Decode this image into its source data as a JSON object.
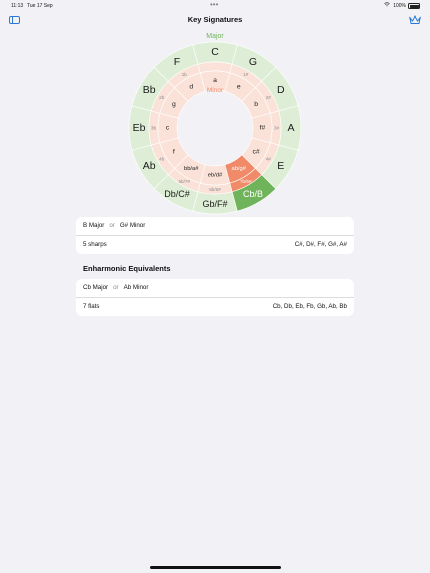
{
  "status_bar": {
    "time": "11:13",
    "date": "Tue 17 Sep",
    "battery": "100%"
  },
  "nav": {
    "title": "Key Signatures"
  },
  "circle": {
    "major_label": "Major",
    "minor_label": "Minor",
    "major_keys": [
      "C",
      "G",
      "D",
      "A",
      "E",
      "Cb/B",
      "Gb/F#",
      "Db/C#",
      "Ab",
      "Eb",
      "Bb",
      "F"
    ],
    "accidentals": [
      "",
      "1#",
      "2#",
      "3#",
      "4#",
      "7b/5#",
      "6b/6#",
      "5b/7#",
      "4b",
      "3b",
      "2b",
      "1b"
    ],
    "minor_keys": [
      "a",
      "e",
      "b",
      "f#",
      "c#",
      "ab/g#",
      "eb/d#",
      "bb/a#",
      "f",
      "c",
      "g",
      "d"
    ],
    "selected_index": 5,
    "colors": {
      "outer_ring": "#deeed6",
      "inner_ring": "#fbe2d8",
      "selected_major": "#6fb35a",
      "selected_minor": "#f08a68",
      "major_label": "#6fb35a",
      "minor_label": "#f08a68"
    }
  },
  "selection": {
    "major": "B Major",
    "or": "or",
    "minor": "G# Minor",
    "count": "5 sharps",
    "notes": "C#, D#, F#, G#, A#"
  },
  "enharmonic": {
    "heading": "Enharmonic Equivalents",
    "major": "Cb Major",
    "or": "or",
    "minor": "Ab Minor",
    "count": "7 flats",
    "notes": "Cb, Db, Eb, Fb, Gb, Ab, Bb"
  },
  "icons": {
    "sidebar": "sidebar-toggle-icon",
    "crown": "crown-icon",
    "wifi": "wifi-icon",
    "battery": "battery-icon"
  }
}
